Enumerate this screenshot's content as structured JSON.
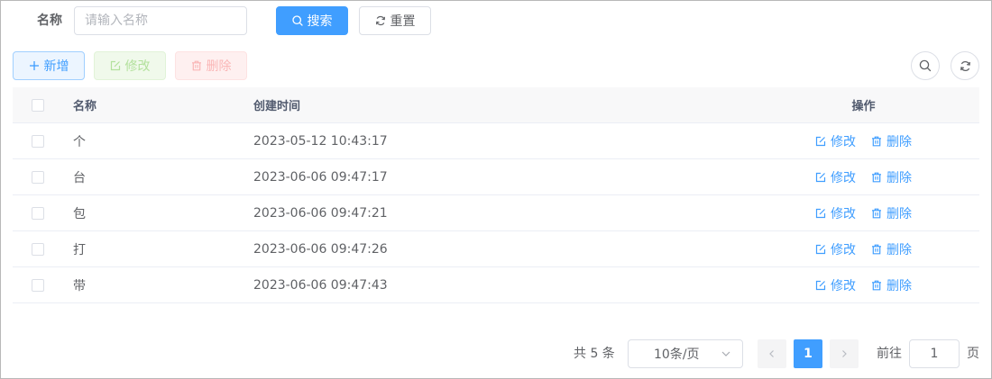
{
  "search": {
    "name_label": "名称",
    "name_placeholder": "请输入名称",
    "name_value": "",
    "search_label": "搜索",
    "reset_label": "重置"
  },
  "toolbar": {
    "add_label": "新增",
    "edit_label": "修改",
    "delete_label": "删除"
  },
  "table": {
    "headers": {
      "name": "名称",
      "created": "创建时间",
      "ops": "操作"
    },
    "rows": [
      {
        "name": "个",
        "created": "2023-05-12 10:43:17",
        "edit": "修改",
        "delete": "删除"
      },
      {
        "name": "台",
        "created": "2023-06-06 09:47:17",
        "edit": "修改",
        "delete": "删除"
      },
      {
        "name": "包",
        "created": "2023-06-06 09:47:21",
        "edit": "修改",
        "delete": "删除"
      },
      {
        "name": "打",
        "created": "2023-06-06 09:47:26",
        "edit": "修改",
        "delete": "删除"
      },
      {
        "name": "带",
        "created": "2023-06-06 09:47:43",
        "edit": "修改",
        "delete": "删除"
      }
    ]
  },
  "pagination": {
    "total_text": "共 5 条",
    "page_size": "10条/页",
    "current_page": "1",
    "goto_prefix": "前往",
    "goto_value": "1",
    "goto_suffix": "页"
  },
  "colors": {
    "primary": "#409eff",
    "success_plain_text": "#b3e19d",
    "danger_plain_text": "#fab6b6",
    "header_bg": "#f8f8f9"
  },
  "icons": {
    "search": "search-icon",
    "reset": "refresh-icon",
    "add": "plus-icon",
    "edit": "edit-icon",
    "delete": "trash-icon",
    "refresh": "refresh-icon",
    "prev": "chevron-left-icon",
    "next": "chevron-right-icon",
    "dropdown": "chevron-down-icon"
  }
}
